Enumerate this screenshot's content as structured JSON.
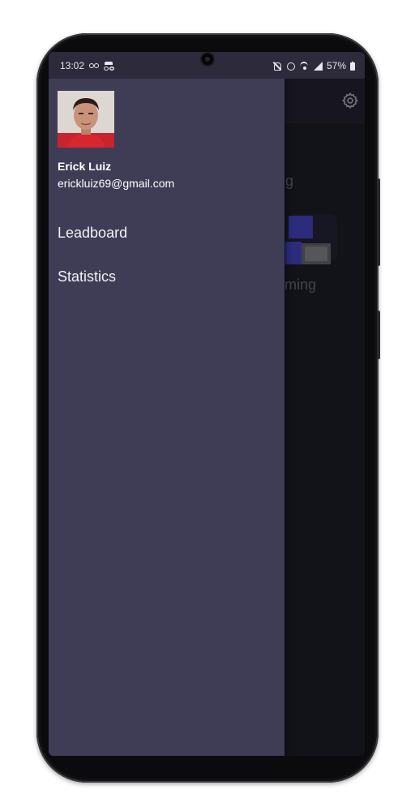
{
  "status_bar": {
    "time": "13:02",
    "battery": "57%",
    "icons": [
      "voicemail-icon",
      "incognito-icon",
      "mute-icon",
      "alarm-icon",
      "wifi-icon",
      "signal-icon",
      "battery-icon"
    ]
  },
  "background_app": {
    "text_line_1": "g",
    "text_line_2": "nming",
    "settings_icon": "gear-icon"
  },
  "drawer": {
    "user": {
      "name": "Erick Luiz",
      "email": "erickluiz69@gmail.com"
    },
    "items": [
      {
        "label": "Leadboard"
      },
      {
        "label": "Statistics"
      }
    ]
  },
  "colors": {
    "drawer_bg": "#3f3d56",
    "status_bar_bg": "#2c2a3b",
    "app_bg": "#1e1d29",
    "accent": "#4a47c8"
  }
}
